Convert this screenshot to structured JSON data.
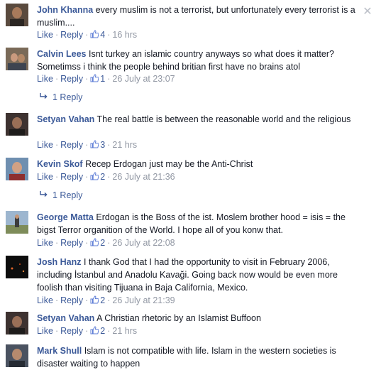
{
  "labels": {
    "like": "Like",
    "reply": "Reply",
    "sep": "·",
    "close": "✕"
  },
  "colors": {
    "link": "#3b5998",
    "meta": "#9197a3",
    "text": "#141823"
  },
  "comments": [
    {
      "author": "John Khanna",
      "text": "every muslim is not a terrorist, but unfortunately every terrorist is a muslim....",
      "likes": "4",
      "time": "16 hrs"
    },
    {
      "author": "Calvin Lees",
      "text": "Isnt turkey an islamic country anyways so what does it matter? Sometimss i think the people behind britian first have no brains atol",
      "likes": "1",
      "time": "26 July at 23:07",
      "replies": "1 Reply"
    },
    {
      "author": "Setyan Vahan",
      "text": "The real battle is between the reasonable world and the religious",
      "likes": "3",
      "time": "21 hrs"
    },
    {
      "author": "Kevin Skof",
      "text": "Recep Erdogan just may be the Anti-Christ",
      "likes": "2",
      "time": "26 July at 21:36",
      "replies": "1 Reply"
    },
    {
      "author": "George Matta",
      "text": "Erdogan is the Boss of the ist. Moslem brother hood = isis = the bigst Terror organition of the World. I hope all of you konw that.",
      "likes": "2",
      "time": "26 July at 22:08"
    },
    {
      "author": "Josh Hanz",
      "text": "I thank God that I had the opportunity to visit in February 2006, including İstanbul and Anadolu Kavaği. Going back now would be even more foolish than visiting Tijuana in Baja California, Mexico.",
      "likes": "2",
      "time": "26 July at 21:39"
    },
    {
      "author": "Setyan Vahan",
      "text": "A Christian rhetoric by an Islamist Buffoon",
      "likes": "2",
      "time": "21 hrs"
    },
    {
      "author": "Mark Shull",
      "text": "Islam is not compatible with life. Islam in the western societies is disaster waiting to happen"
    }
  ]
}
